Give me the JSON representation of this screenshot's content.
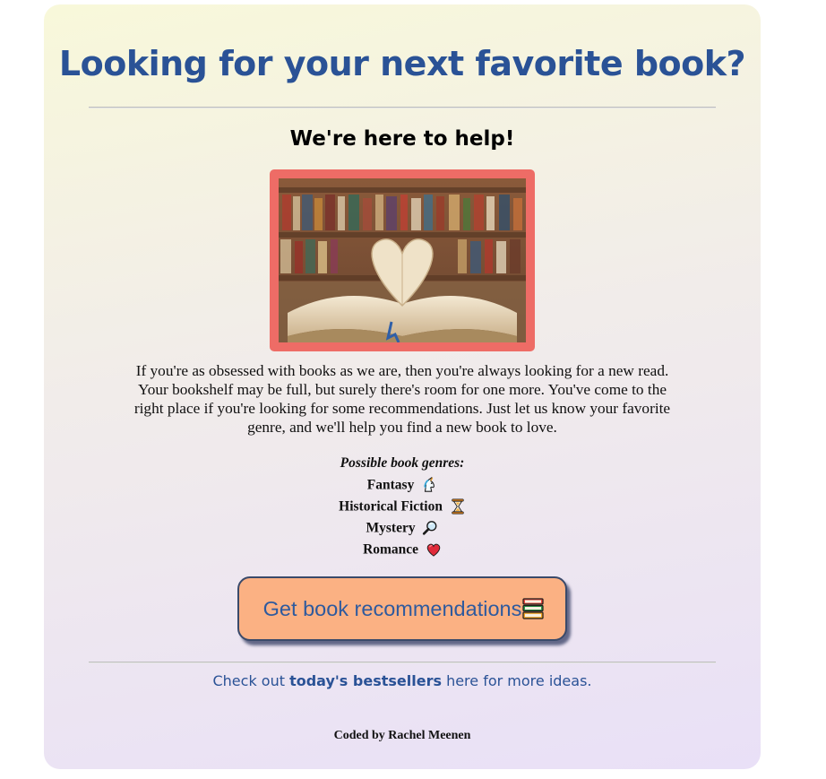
{
  "page": {
    "title": "Looking for your next favorite book?",
    "subtitle": "We're here to help!",
    "intro": "If you're as obsessed with books as we are, then you're always looking for a new read. Your bookshelf may be full, but surely there's room for one more. You've come to the right place if you're looking for some recommendations. Just let us know your favorite genre, and we'll help you find a new book to love."
  },
  "genres": {
    "heading": "Possible book genres:",
    "items": [
      {
        "label": "Fantasy",
        "icon": "unicorn-icon"
      },
      {
        "label": "Historical Fiction",
        "icon": "hourglass-icon"
      },
      {
        "label": "Mystery",
        "icon": "magnifying-glass-icon"
      },
      {
        "label": "Romance",
        "icon": "heart-icon"
      }
    ]
  },
  "button": {
    "label": "Get book recommendations",
    "icon": "books-icon"
  },
  "footer": {
    "prefix": "Check out ",
    "link": "today's bestsellers",
    "suffix": " here for more ideas."
  },
  "credit": "Coded by Rachel Meenen",
  "colors": {
    "title": "#2a5296",
    "frame": "#ee6c66",
    "button_bg": "#fbb183",
    "button_text": "#2e5a9e"
  }
}
